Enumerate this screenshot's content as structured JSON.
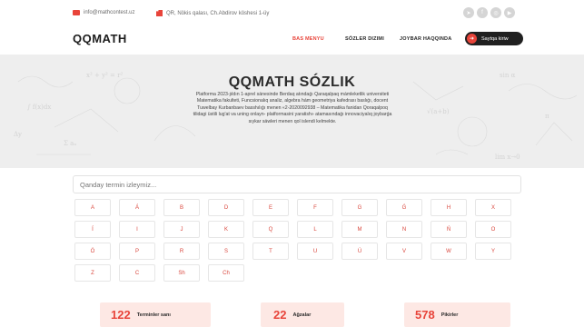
{
  "topbar": {
    "email": "info@mathcontest.uz",
    "address": "QR, Nökis qalası, Ch.Abdirov köshesi 1-üy",
    "socials": [
      {
        "icon": "telegram-icon",
        "glyph": "➤"
      },
      {
        "icon": "facebook-icon",
        "glyph": "f"
      },
      {
        "icon": "instagram-icon",
        "glyph": "◎"
      },
      {
        "icon": "youtube-icon",
        "glyph": "▶"
      }
    ]
  },
  "nav": {
    "logo": "QQMATH",
    "links": [
      "BAS MENYU",
      "SÓZLER DIZIMI",
      "JOYBAR HAQQINDA"
    ],
    "login_label": "Saytqa kiriw"
  },
  "hero": {
    "title": "QQMATH SÓZLIK",
    "description": "Platforma 2023-jıldın 1-aprel sánesinde Berdaq atındaǵı Qaraqalpaq mámleketlik universiteti Matematika fakulteti, Funcsionalıq analiz, algebra hám geometriya kafedrası baslıǵı, docent Tuwelbay Kurbanbaev basshılıǵı menen «2-2020092938 – Matematika fanidan Qoraqalpoq tilidagi üstili lug'at va uning onlayn- platformasini yaratish» atamasındaǵı innovaciyalıq joybarǵa sıykar sáwleri menen qol islendi kelmekte."
  },
  "search": {
    "placeholder": "Qanday termin izleymiz..."
  },
  "letters": [
    "A",
    "Á",
    "B",
    "D",
    "E",
    "F",
    "G",
    "Ǵ",
    "H",
    "X",
    "Í",
    "I",
    "J",
    "K",
    "Q",
    "L",
    "M",
    "N",
    "Ń",
    "O",
    "Ó",
    "P",
    "R",
    "S",
    "T",
    "U",
    "Ú",
    "V",
    "W",
    "Y",
    "Z",
    "C",
    "Sh",
    "Ch"
  ],
  "stats": [
    {
      "value": "122",
      "label": "Terminler sanı"
    },
    {
      "value": "22",
      "label": "Ağzalar"
    },
    {
      "value": "578",
      "label": "Pikirler"
    }
  ],
  "colors": {
    "accent": "#e8443a",
    "dark": "#202020",
    "hero_bg": "#eeeeee",
    "stat_bg": "#fde8e4"
  }
}
